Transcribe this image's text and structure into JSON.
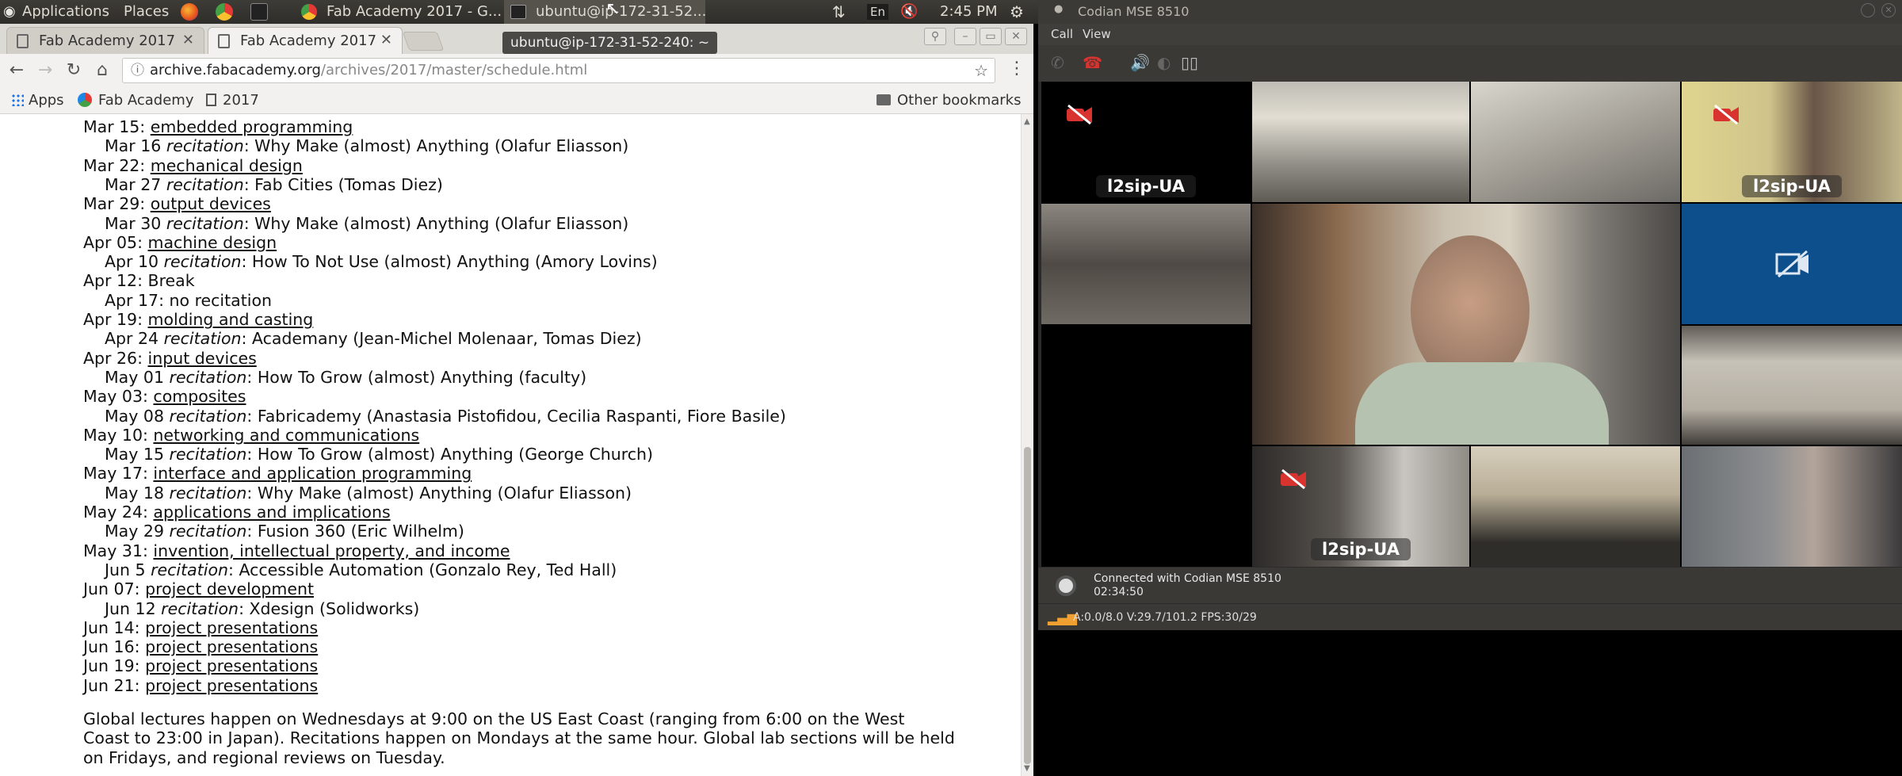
{
  "top_panel": {
    "applications": "Applications",
    "places": "Places",
    "task_browser": "Fab Academy 2017 - G...",
    "task_terminal": "ubuntu@ip-172-31-52...",
    "keyboard_layout": "En",
    "clock": "2:45 PM"
  },
  "browser": {
    "tabs": [
      {
        "title": "Fab Academy 2017"
      },
      {
        "title": "Fab Academy 2017"
      }
    ],
    "tooltip": "ubuntu@ip-172-31-52-240: ~",
    "url_host": "archive.fabacademy.org",
    "url_path": "/archives/2017/master/schedule.html",
    "bookmarks": {
      "apps": "Apps",
      "fab_academy": "Fab Academy",
      "year": "2017",
      "other": "Other bookmarks"
    },
    "schedule": [
      {
        "date": "Mar 15:",
        "topic": "embedded programming"
      },
      {
        "date": "Mar 16",
        "kind": "recitation",
        "detail": ": Why Make (almost) Anything (Olafur Eliasson)"
      },
      {
        "date": "Mar 22:",
        "topic": "mechanical design"
      },
      {
        "date": "Mar 27",
        "kind": "recitation",
        "detail": ": Fab Cities (Tomas Diez)"
      },
      {
        "date": "Mar 29:",
        "topic": "output devices"
      },
      {
        "date": "Mar 30",
        "kind": "recitation",
        "detail": ": Why Make (almost) Anything (Olafur Eliasson)"
      },
      {
        "date": "Apr 05:",
        "topic": "machine design"
      },
      {
        "date": "Apr 10",
        "kind": "recitation",
        "detail": ": How To Not Use (almost) Anything (Amory Lovins)"
      },
      {
        "date": "Apr 12:",
        "plain": "Break"
      },
      {
        "date": "Apr 17:",
        "plain": "no recitation",
        "indent": true
      },
      {
        "date": "Apr 19:",
        "topic": "molding and casting"
      },
      {
        "date": "Apr 24",
        "kind": "recitation",
        "detail": ": Academany (Jean-Michel Molenaar, Tomas Diez)"
      },
      {
        "date": "Apr 26:",
        "topic": "input devices"
      },
      {
        "date": "May 01",
        "kind": "recitation",
        "detail": ": How To Grow (almost) Anything (faculty)"
      },
      {
        "date": "May 03:",
        "topic": "composites"
      },
      {
        "date": "May 08",
        "kind": "recitation",
        "detail": ": Fabricademy (Anastasia Pistofidou, Cecilia Raspanti, Fiore Basile)"
      },
      {
        "date": "May 10:",
        "topic": "networking and communications"
      },
      {
        "date": "May 15",
        "kind": "recitation",
        "detail": ": How To Grow (almost) Anything (George Church)"
      },
      {
        "date": "May 17:",
        "topic": "interface and application programming"
      },
      {
        "date": "May 18",
        "kind": "recitation",
        "detail": ": Why Make (almost) Anything (Olafur Eliasson)"
      },
      {
        "date": "May 24:",
        "topic": "applications and implications"
      },
      {
        "date": "May 29",
        "kind": "recitation",
        "detail": ": Fusion 360 (Eric Wilhelm)"
      },
      {
        "date": "May 31:",
        "topic": "invention, intellectual property, and income"
      },
      {
        "date": "Jun 5",
        "kind": "recitation",
        "detail": ": Accessible Automation (Gonzalo Rey, Ted Hall)"
      },
      {
        "date": "Jun 07:",
        "topic": "project development"
      },
      {
        "date": "Jun 12",
        "kind": "recitation",
        "detail": ": Xdesign (Solidworks)"
      },
      {
        "date": "Jun 14:",
        "topic": "project presentations"
      },
      {
        "date": "Jun 16:",
        "topic": "project presentations"
      },
      {
        "date": "Jun 19:",
        "topic": "project presentations"
      },
      {
        "date": "Jun 21:",
        "topic": "project presentations"
      }
    ],
    "footer_note": "Global lectures happen on Wednesdays at 9:00 on the US East Coast (ranging from 6:00 on the West Coast to 23:00 in Japan). Recitations happen on Mondays at the same hour. Global lab sections will be held on Fridays, and regional reviews on Tuesday."
  },
  "codian": {
    "title": "Codian MSE 8510",
    "menu": [
      "Call",
      "View"
    ],
    "tile_label": "l2sip-UA",
    "status_line1": "Connected with Codian MSE 8510",
    "status_line2": "02:34:50",
    "stats": "A:0.0/8.0 V:29.7/101.2 FPS:30/29"
  },
  "colors": {
    "panel": "#3d3c37",
    "link": "#111111",
    "hangup_red": "#d8332f",
    "video_blue": "#0d4e8c"
  }
}
